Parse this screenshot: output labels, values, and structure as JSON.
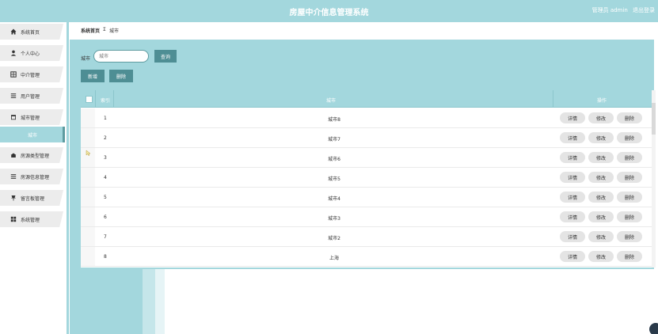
{
  "header": {
    "title": "房屋中介信息管理系统",
    "user_label": "管理员 admin",
    "logout": "退出登录"
  },
  "sidebar": {
    "items": [
      {
        "label": "系统首页",
        "icon": "home-icon"
      },
      {
        "label": "个人中心",
        "icon": "person-icon"
      },
      {
        "label": "中介管理",
        "icon": "grid-icon"
      },
      {
        "label": "用户管理",
        "icon": "list-icon"
      },
      {
        "label": "城市管理",
        "icon": "calendar-icon"
      },
      {
        "label": "城市",
        "icon": ""
      },
      {
        "label": "房源类型管理",
        "icon": "house-icon"
      },
      {
        "label": "房源信息管理",
        "icon": "list-icon"
      },
      {
        "label": "留言板管理",
        "icon": "pin-icon"
      },
      {
        "label": "系统管理",
        "icon": "apps-icon"
      }
    ]
  },
  "breadcrumb": {
    "home": "系统首页",
    "separator": "Σ",
    "current": "城市"
  },
  "search": {
    "label": "城市",
    "placeholder": "城市",
    "query_button": "查询"
  },
  "actions": {
    "add": "新增",
    "delete": "删除"
  },
  "table": {
    "headers": {
      "index": "索引",
      "city": "城市",
      "operation": "操作"
    },
    "row_buttons": {
      "detail": "详情",
      "edit": "修改",
      "delete": "删除"
    },
    "rows": [
      {
        "index": "1",
        "city": "城市8"
      },
      {
        "index": "2",
        "city": "城市7"
      },
      {
        "index": "3",
        "city": "城市6"
      },
      {
        "index": "4",
        "city": "城市5"
      },
      {
        "index": "5",
        "city": "城市4"
      },
      {
        "index": "6",
        "city": "城市3"
      },
      {
        "index": "7",
        "city": "城市2"
      },
      {
        "index": "8",
        "city": "上海"
      }
    ]
  },
  "colors": {
    "accent": "#a3d7dd",
    "button": "#4e8e94"
  }
}
